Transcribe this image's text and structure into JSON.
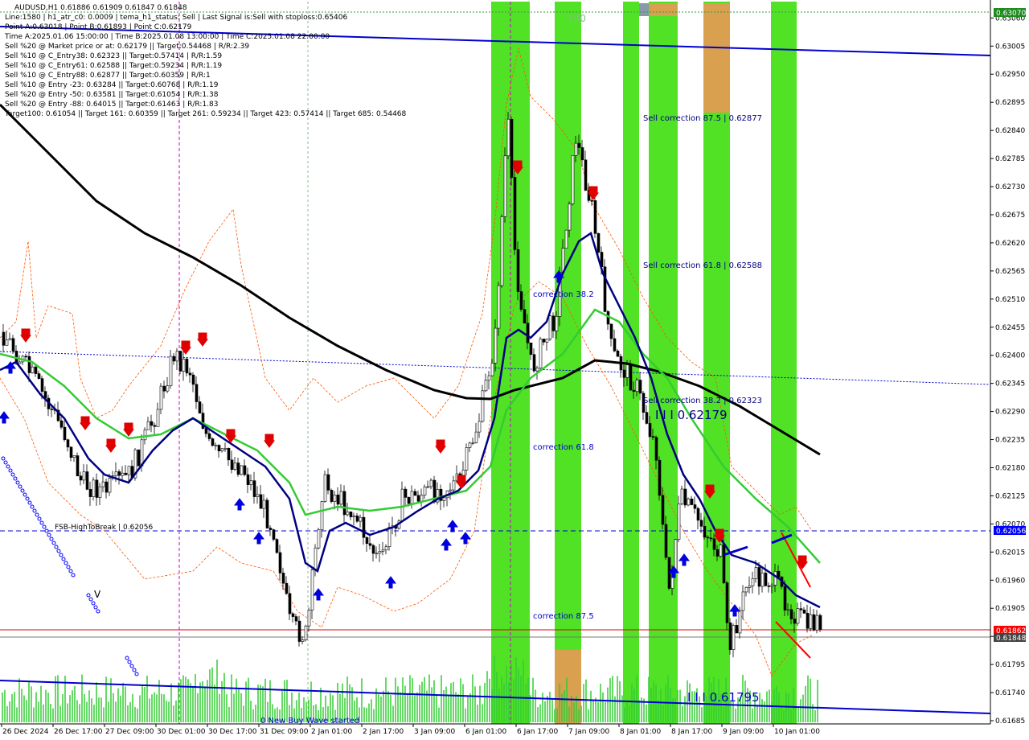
{
  "header": {
    "symbol_line": "AUDUSD,H1  0.61886 0.61909 0.61847 0.61848",
    "lines": [
      "Line:1580 | h1_atr_c0: 0.0009 | tema_h1_status: Sell | Last Signal is:Sell with stoploss:0.65406",
      "Point A:0.63018 | Point B:0.61893 | Point C:0.62179",
      "Time A:2025.01.06 15:00:00 | Time B:2025.01.08 13:00:00 | Time C:2025.01.08 22:00:00",
      "Sell %20 @ Market price or at: 0.62179 || Target:0.54468 | R/R:2.39",
      "Sell %10 @ C_Entry38: 0.62323 || Target:0.57414 | R/R:1.59",
      "Sell %10 @ C_Entry61: 0.62588 || Target:0.59234 | R/R:1.19",
      "Sell %10 @ C_Entry88: 0.62877 || Target:0.60359 | R/R:1",
      "Sell %10 @ Entry -23: 0.63284 || Target:0.60768 | R/R:1.19",
      "Sell %20 @ Entry -50: 0.63581 || Target:0.61054 | R/R:1.38",
      "Sell %20 @ Entry -88: 0.64015 || Target:0.61463 | R/R:1.83",
      "Target100: 0.61054 || Target 161: 0.60359 || Target 261: 0.59234 || Target 423: 0.57414 || Target 685: 0.54468"
    ]
  },
  "annotations": {
    "sell_correction_875": "Sell correction 87.5 | 0.62877",
    "sell_correction_618": "Sell correction 61.8 | 0.62588",
    "sell_correction_382": "Sell correction 38.2 | 0.62323",
    "point_c": "I I I 0.62179",
    "point_b": "I I I 0.61795",
    "correction_382": "correction 38.2",
    "correction_618": "correction 61.8",
    "correction_875": "correction 87.5",
    "fsb": "FSB-HighToBreak | 0.62056",
    "new_wave": "0 New Buy Wave started",
    "top_label": "100",
    "v_mark": "V"
  },
  "price_badges": {
    "top": "0.63070",
    "blue_level": "0.62056",
    "red_level": "0.61862",
    "current": "0.61848"
  },
  "colors": {
    "green_zone": "#33dd00",
    "orange_zone": "#d9a050",
    "main_blue": "#0000cc",
    "ma_green": "#33cc33",
    "ma_black": "#000000",
    "ma_navy": "#000080",
    "red_level": "#e00000",
    "badge_green": "#1e8c1e",
    "badge_blue": "#0000ff",
    "badge_red": "#ff0000",
    "badge_gray": "#444444"
  },
  "chart_data": {
    "type": "candlestick",
    "symbol": "AUDUSD",
    "timeframe": "H1",
    "ohlc_last": {
      "open": 0.61886,
      "high": 0.61909,
      "low": 0.61847,
      "close": 0.61848
    },
    "ylim": [
      0.61685,
      0.6307
    ],
    "y_ticks": [
      "0.63060",
      "0.63005",
      "0.62950",
      "0.62895",
      "0.62840",
      "0.62785",
      "0.62730",
      "0.62675",
      "0.62620",
      "0.62565",
      "0.62510",
      "0.62455",
      "0.62400",
      "0.62345",
      "0.62290",
      "0.62235",
      "0.62180",
      "0.62125",
      "0.62070",
      "0.62015",
      "0.61960",
      "0.61905",
      "0.61850",
      "0.61795",
      "0.61740",
      "0.61685"
    ],
    "x_ticks": [
      "26 Dec 2024",
      "26 Dec 17:00",
      "27 Dec 09:00",
      "30 Dec 01:00",
      "30 Dec 17:00",
      "31 Dec 09:00",
      "2 Jan 01:00",
      "2 Jan 17:00",
      "3 Jan 09:00",
      "6 Jan 01:00",
      "6 Jan 17:00",
      "7 Jan 09:00",
      "8 Jan 01:00",
      "8 Jan 17:00",
      "9 Jan 09:00",
      "10 Jan 01:00"
    ],
    "levels": [
      {
        "name": "fsb-high-to-break",
        "value": 0.62056
      },
      {
        "name": "red-level",
        "value": 0.61862
      },
      {
        "name": "current-price",
        "value": 0.61848
      }
    ]
  }
}
